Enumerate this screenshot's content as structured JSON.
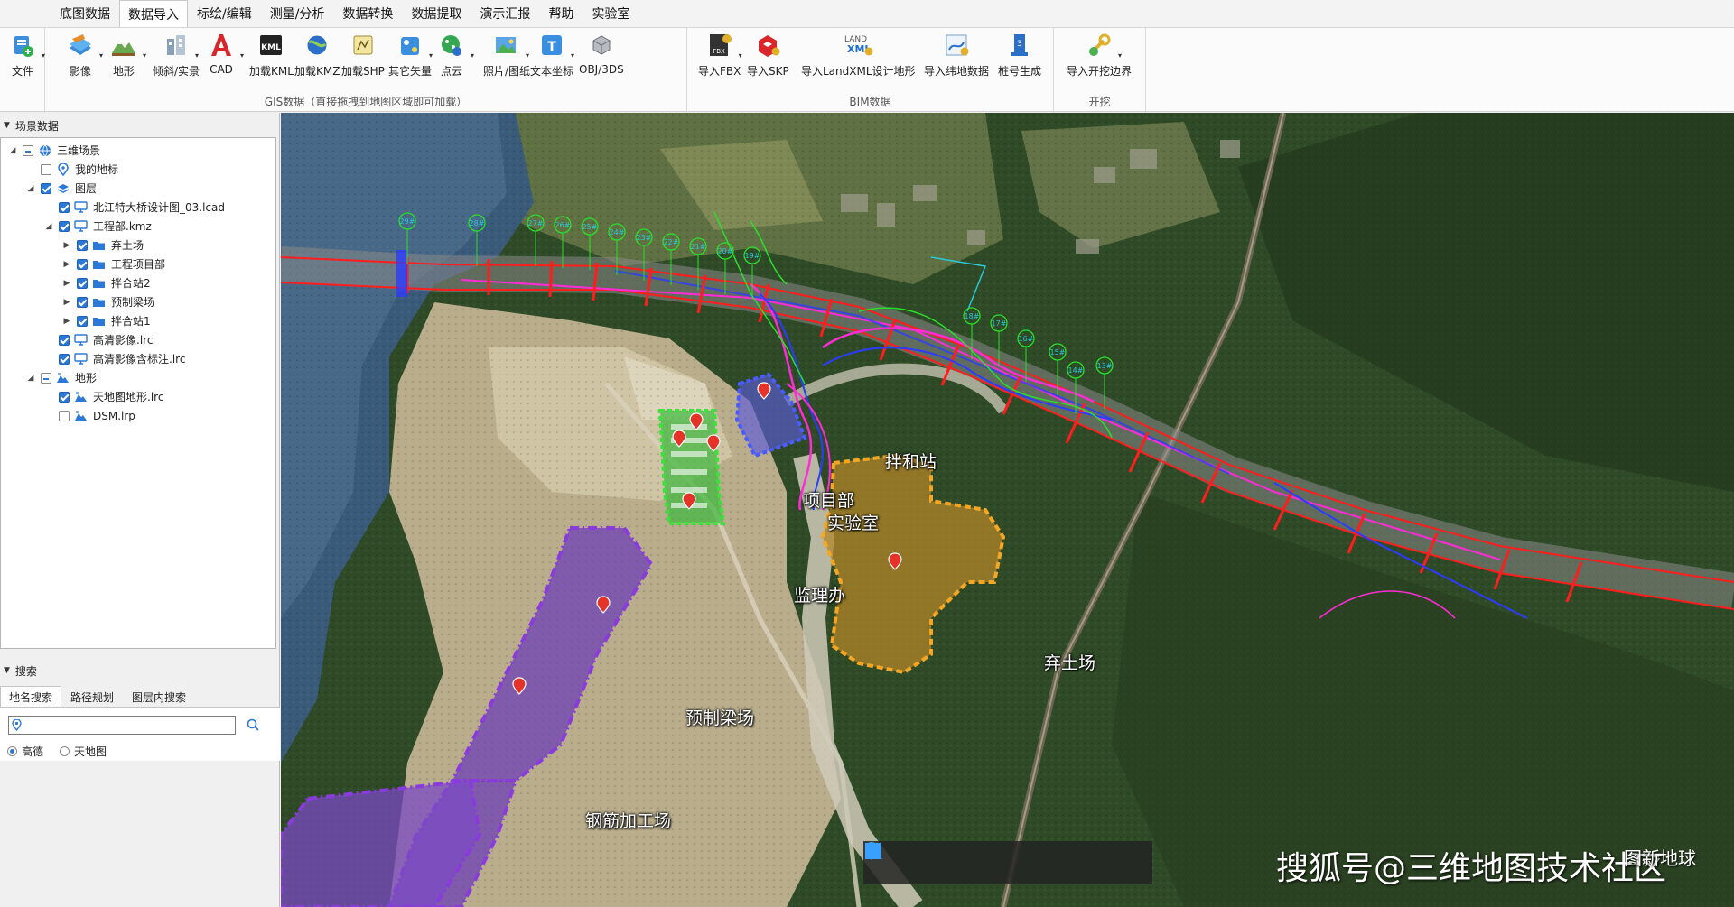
{
  "menu": {
    "items": [
      "底图数据",
      "数据导入",
      "标绘/编辑",
      "测量/分析",
      "数据转换",
      "数据提取",
      "演示汇报",
      "帮助",
      "实验室"
    ],
    "active_index": 1
  },
  "ribbon": {
    "file": "文件",
    "gis_buttons": [
      "影像",
      "地形",
      "倾斜/实景",
      "CAD",
      "加载KML",
      "加载KMZ",
      "加载SHP",
      "其它矢量",
      "点云",
      "照片/图纸",
      "文本坐标",
      "OBJ/3DS"
    ],
    "gis_group_label": "GIS数据（直接拖拽到地图区域即可加载）",
    "bim_buttons": [
      "导入FBX",
      "导入SKP",
      "导入LandXML设计地形",
      "导入纬地数据",
      "桩号生成"
    ],
    "bim_group_label": "BIM数据",
    "dig_buttons": [
      "导入开挖边界"
    ],
    "dig_group_label": "开挖"
  },
  "scene_panel": {
    "title": "场景数据",
    "tree": [
      {
        "label": "三维场景",
        "level": 0,
        "expand": "open",
        "check": "partial",
        "icon": "globe-icon"
      },
      {
        "label": "我的地标",
        "level": 1,
        "expand": "none",
        "check": "unchecked",
        "icon": "pin-icon"
      },
      {
        "label": "图层",
        "level": 1,
        "expand": "open",
        "check": "checked",
        "icon": "layers-icon"
      },
      {
        "label": "北江特大桥设计图_03.lcad",
        "level": 2,
        "expand": "none",
        "check": "checked",
        "icon": "monitor-icon"
      },
      {
        "label": "工程部.kmz",
        "level": 2,
        "expand": "open",
        "check": "checked",
        "icon": "monitor-icon"
      },
      {
        "label": "弃土场",
        "level": 3,
        "expand": "closed",
        "check": "checked",
        "icon": "folder-icon"
      },
      {
        "label": "工程项目部",
        "level": 3,
        "expand": "closed",
        "check": "checked",
        "icon": "folder-icon"
      },
      {
        "label": "拌合站2",
        "level": 3,
        "expand": "closed",
        "check": "checked",
        "icon": "folder-icon"
      },
      {
        "label": "预制梁场",
        "level": 3,
        "expand": "closed",
        "check": "checked",
        "icon": "folder-icon"
      },
      {
        "label": "拌合站1",
        "level": 3,
        "expand": "closed",
        "check": "checked",
        "icon": "folder-icon"
      },
      {
        "label": "高清影像.lrc",
        "level": 2,
        "expand": "none",
        "check": "checked",
        "icon": "monitor-icon"
      },
      {
        "label": "高清影像含标注.lrc",
        "level": 2,
        "expand": "none",
        "check": "checked",
        "icon": "monitor-icon"
      },
      {
        "label": "地形",
        "level": 1,
        "expand": "open",
        "check": "partial",
        "icon": "terrain-icon"
      },
      {
        "label": "天地图地形.lrc",
        "level": 2,
        "expand": "none",
        "check": "checked",
        "icon": "terrain-icon"
      },
      {
        "label": "DSM.lrp",
        "level": 2,
        "expand": "none",
        "check": "unchecked",
        "icon": "terrain-icon"
      }
    ]
  },
  "search_panel": {
    "title": "搜索",
    "tabs": [
      "地名搜索",
      "路径规划",
      "图层内搜索"
    ],
    "active_tab": 0,
    "input_value": "",
    "radio_options": [
      "高德",
      "天地图"
    ],
    "radio_selected": 0
  },
  "map": {
    "labels": {
      "mixing_station": "拌和站",
      "project_dept": "项目部",
      "lab": "实验室",
      "supervision": "监理办",
      "spoil_ground": "弃土场",
      "precast_yard": "预制梁场",
      "rebar_yard": "钢筋加工场"
    },
    "pier_labels": [
      "29#",
      "28#",
      "27#",
      "26#",
      "25#",
      "24#",
      "23#",
      "22#",
      "21#",
      "20#",
      "19#",
      "18#",
      "17#",
      "16#",
      "15#",
      "14#",
      "13#"
    ],
    "colors": {
      "spoil": "#f5a623",
      "precast": "#8a3bdc",
      "office": "#3ee03e",
      "mixing": "#4a5cff",
      "road_red": "#ff1d1d",
      "road_magenta": "#ff2bd6"
    }
  },
  "map_toolbar": {
    "tools": [
      "hand-icon",
      "pointer-icon",
      "pin-icon",
      "line-icon",
      "rectangle-icon",
      "chart-icon"
    ]
  },
  "watermark": {
    "text": "搜狐号@三维地图技术社区",
    "brand": "图新地球"
  }
}
